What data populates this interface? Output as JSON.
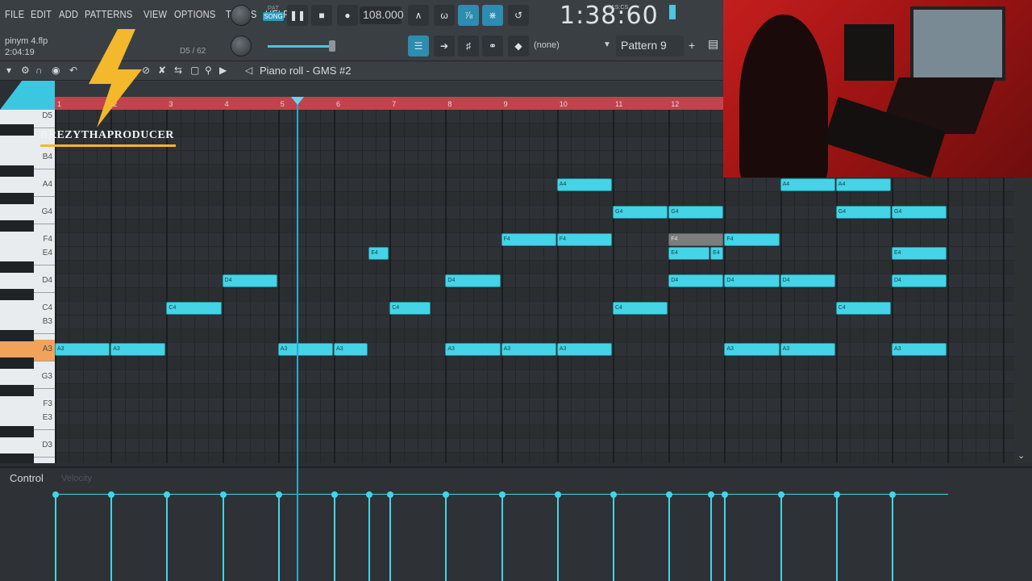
{
  "menu": [
    "FILE",
    "EDIT",
    "ADD",
    "PATTERNS",
    "VIEW",
    "OPTIONS",
    "TOOLS",
    "HELP"
  ],
  "mode": {
    "pat": "PAT",
    "song": "SONG"
  },
  "tempo": "108.000",
  "time": {
    "value": "1:38:60",
    "unit": "M:S:CS"
  },
  "file": {
    "name": "pinym 4.flp",
    "duration": "2:04:19"
  },
  "position": "D5 / 62",
  "channel": "(none)",
  "pattern": "Pattern 9",
  "piano_roll_title": "Piano roll - GMS #2",
  "bars": [
    "1",
    "2",
    "3",
    "4",
    "5",
    "6",
    "7",
    "8",
    "9",
    "10",
    "11",
    "12"
  ],
  "key_labels": [
    "D5",
    "B4",
    "A4",
    "G4",
    "F4",
    "E4",
    "D4",
    "C4",
    "B3",
    "A3",
    "G3",
    "F3",
    "E3",
    "D3"
  ],
  "control": {
    "label": "Control",
    "target": "Velocity"
  },
  "logo_text": "BREZYTHAPRODUCER",
  "notes": [
    {
      "pitch": "A3",
      "start": 0,
      "len": 1.0
    },
    {
      "pitch": "A3",
      "start": 1.0,
      "len": 1.0
    },
    {
      "pitch": "C4",
      "start": 2.0,
      "len": 1.0
    },
    {
      "pitch": "D4",
      "start": 3.0,
      "len": 1.0
    },
    {
      "pitch": "A3",
      "start": 4.0,
      "len": 1.0
    },
    {
      "pitch": "A3",
      "start": 5.0,
      "len": 0.625
    },
    {
      "pitch": "E4",
      "start": 5.625,
      "len": 0.375
    },
    {
      "pitch": "C4",
      "start": 6.0,
      "len": 0.75
    },
    {
      "pitch": "D4",
      "start": 7.0,
      "len": 1.0
    },
    {
      "pitch": "A3",
      "start": 7.0,
      "len": 1.0
    },
    {
      "pitch": "F4",
      "start": 8.0,
      "len": 1.0
    },
    {
      "pitch": "A3",
      "start": 8.0,
      "len": 1.0
    },
    {
      "pitch": "A4",
      "start": 9.0,
      "len": 1.0
    },
    {
      "pitch": "F4",
      "start": 9.0,
      "len": 1.0
    },
    {
      "pitch": "A3",
      "start": 9.0,
      "len": 1.0
    },
    {
      "pitch": "G4",
      "start": 10.0,
      "len": 1.0
    },
    {
      "pitch": "C4",
      "start": 10.0,
      "len": 1.0
    },
    {
      "pitch": "G4",
      "start": 11.0,
      "len": 1.0
    },
    {
      "pitch": "F4",
      "start": 11.0,
      "len": 1.0,
      "sel": true
    },
    {
      "pitch": "E4",
      "start": 11.0,
      "len": 0.75
    },
    {
      "pitch": "E4",
      "start": 11.75,
      "len": 0.25
    },
    {
      "pitch": "D4",
      "start": 11.0,
      "len": 1.0
    },
    {
      "pitch": "F4",
      "start": 12.0,
      "len": 1.0
    },
    {
      "pitch": "D4",
      "start": 12.0,
      "len": 1.0
    },
    {
      "pitch": "A3",
      "start": 12.0,
      "len": 1.0
    },
    {
      "pitch": "A4",
      "start": 13.0,
      "len": 1.0
    },
    {
      "pitch": "D4",
      "start": 13.0,
      "len": 1.0
    },
    {
      "pitch": "A3",
      "start": 13.0,
      "len": 1.0
    },
    {
      "pitch": "A4",
      "start": 14.0,
      "len": 1.0
    },
    {
      "pitch": "G4",
      "start": 14.0,
      "len": 1.0
    },
    {
      "pitch": "C4",
      "start": 14.0,
      "len": 1.0
    },
    {
      "pitch": "G4",
      "start": 15.0,
      "len": 1.0
    },
    {
      "pitch": "E4",
      "start": 15.0,
      "len": 1.0
    },
    {
      "pitch": "D4",
      "start": 15.0,
      "len": 1.0
    },
    {
      "pitch": "A3",
      "start": 15.0,
      "len": 1.0
    }
  ]
}
